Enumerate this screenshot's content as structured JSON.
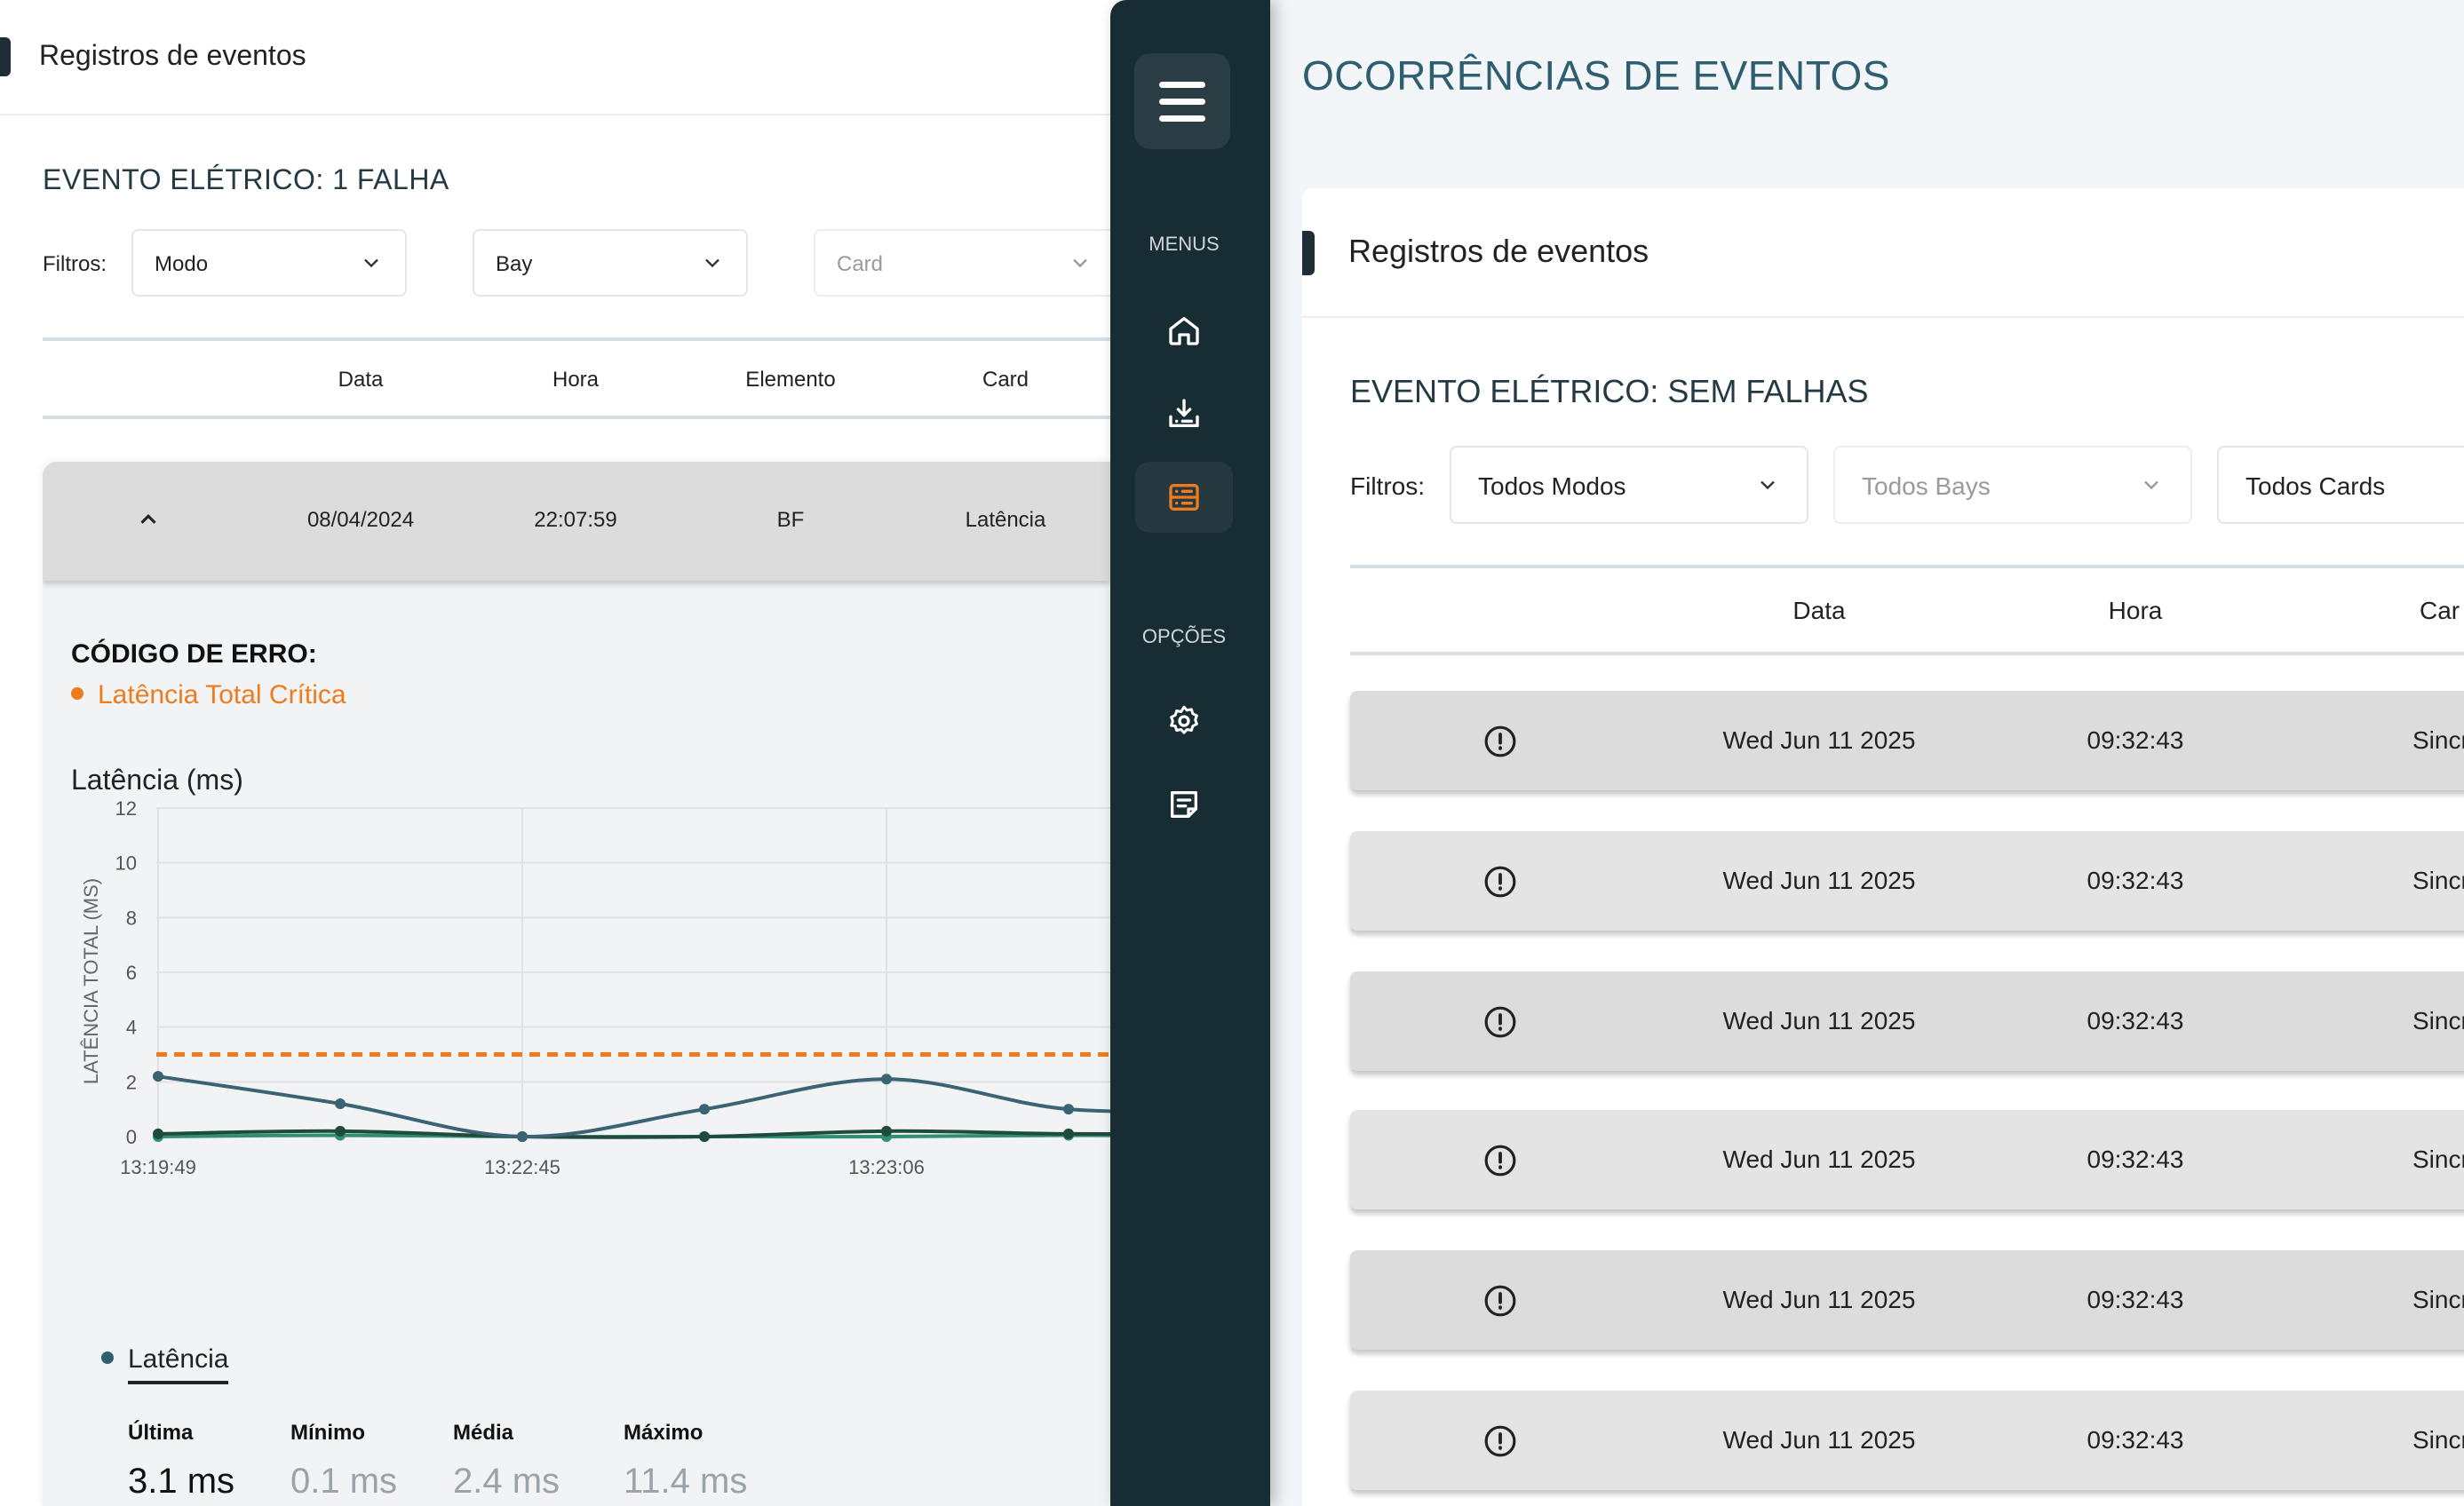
{
  "left": {
    "header_title": "Registros de eventos",
    "section_title": "EVENTO ELÉTRICO: 1 FALHA",
    "filters_label": "Filtros:",
    "filters": [
      "Modo",
      "Bay",
      "Card"
    ],
    "columns": [
      "Data",
      "Hora",
      "Elemento",
      "Card"
    ],
    "row": {
      "data": "08/04/2024",
      "hora": "22:07:59",
      "elemento": "BF",
      "card": "Latência"
    },
    "error_title": "CÓDIGO DE ERRO:",
    "error_item": "Latência Total Crítica",
    "chart_title": "Latência (ms)",
    "legend": "Latência",
    "stats": [
      {
        "label": "Última",
        "value": "3.1 ms"
      },
      {
        "label": "Mínimo",
        "value": "0.1 ms"
      },
      {
        "label": "Média",
        "value": "2.4 ms"
      },
      {
        "label": "Máximo",
        "value": "11.4 ms"
      }
    ]
  },
  "chart_data": {
    "type": "line",
    "ylabel": "LATÊNCIA TOTAL (MS)",
    "ylim": [
      0,
      12
    ],
    "yticks": [
      "0",
      "2",
      "4",
      "6",
      "8",
      "10",
      "12"
    ],
    "x_tick_labels": [
      "13:19:49",
      "13:22:45",
      "13:23:06"
    ],
    "threshold": 3,
    "threshold_color": "#ef7b1d",
    "series": [
      {
        "values": [
          2.2,
          1.2,
          0.0,
          1.0,
          2.1,
          1.0,
          1.0
        ],
        "color": "#3a6373"
      },
      {
        "values": [
          0.1,
          0.2,
          0.0,
          0.0,
          0.2,
          0.1,
          0.1
        ],
        "color": "#1f4a3c"
      },
      {
        "values": [
          0.0,
          0.05,
          0.0,
          0.0,
          0.0,
          0.05,
          0.0
        ],
        "color": "#2f8f6f"
      }
    ]
  },
  "sidebar": {
    "menus_label": "MENUS",
    "options_label": "OPÇÕES",
    "icons": [
      "home-icon",
      "download-icon",
      "server-icon",
      "gear-icon",
      "notes-icon"
    ],
    "active_color": "#ef7b1d"
  },
  "right": {
    "page_title": "OCORRÊNCIAS DE EVENTOS",
    "header_title": "Registros de eventos",
    "section_title": "EVENTO ELÉTRICO: SEM FALHAS",
    "filters_label": "Filtros:",
    "filters": [
      "Todos Modos",
      "Todos Bays",
      "Todos Cards"
    ],
    "columns": [
      "Data",
      "Hora",
      "Car"
    ],
    "rows": [
      {
        "data": "Wed Jun 11 2025",
        "hora": "09:32:43",
        "card": "Sincronismo"
      },
      {
        "data": "Wed Jun 11 2025",
        "hora": "09:32:43",
        "card": "Sincronismo"
      },
      {
        "data": "Wed Jun 11 2025",
        "hora": "09:32:43",
        "card": "Sincronismo"
      },
      {
        "data": "Wed Jun 11 2025",
        "hora": "09:32:43",
        "card": "Sincronismo"
      },
      {
        "data": "Wed Jun 11 2025",
        "hora": "09:32:43",
        "card": "Sincronismo"
      },
      {
        "data": "Wed Jun 11 2025",
        "hora": "09:32:43",
        "card": "Sincronismo"
      }
    ]
  }
}
